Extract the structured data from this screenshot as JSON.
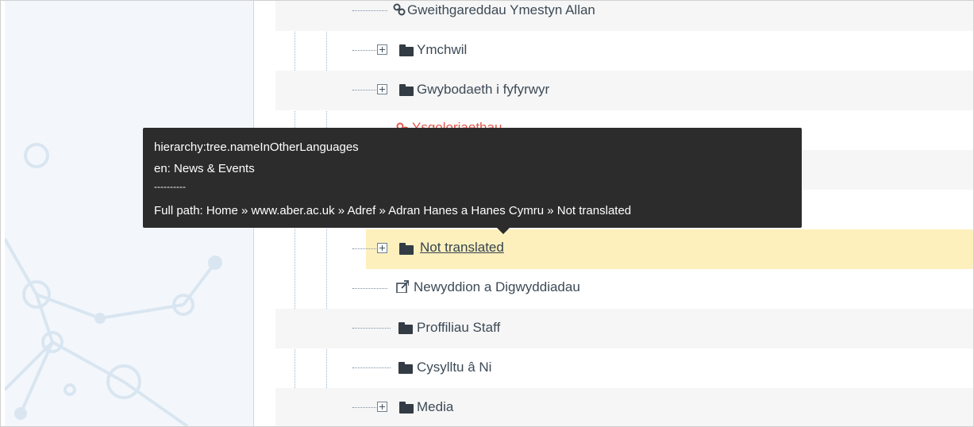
{
  "tree": {
    "items": [
      {
        "label": "Gweithgareddau Ymestyn Allan",
        "icon": "link-icon"
      },
      {
        "label": "Ymchwil",
        "icon": "folder-icon",
        "expandable": true
      },
      {
        "label": "Gwybodaeth i fyfyrwyr",
        "icon": "folder-icon",
        "expandable": true
      },
      {
        "label": "Ysgoloriaethau",
        "icon": "link-icon"
      },
      {
        "label": "Not translated",
        "icon": "folder-icon",
        "expandable": true,
        "selected": true
      },
      {
        "label": "Newyddion a Digwyddiadau",
        "icon": "external-link-icon"
      },
      {
        "label": "Proffiliau Staff",
        "icon": "folder-icon"
      },
      {
        "label": "Cysylltu â Ni",
        "icon": "folder-icon"
      },
      {
        "label": "Media",
        "icon": "folder-icon",
        "expandable": true
      }
    ]
  },
  "tooltip": {
    "line1": "hierarchy:tree.nameInOtherLanguages",
    "line2": "en: News & Events",
    "line3": "----------",
    "line4": "Full path: Home » www.aber.ac.uk » Adref » Adran Hanes a Hanes Cymru » Not translated"
  },
  "colors": {
    "link_text": "#e1574a",
    "highlight_row": "#fdf0bd",
    "tooltip_bg": "#2c2c2c",
    "sidebar_bg": "#f3f7fb"
  }
}
